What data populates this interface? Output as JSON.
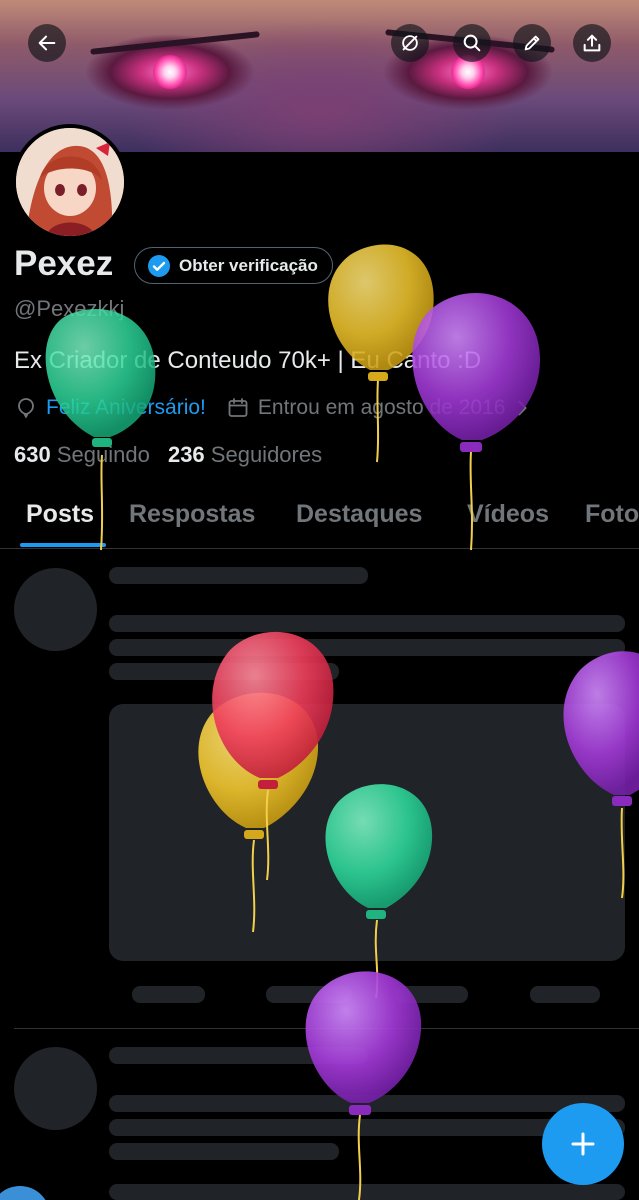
{
  "profile": {
    "name": "Pexez",
    "handle": "@Pexezkkj",
    "verify_button": "Obter verificação",
    "bio": "Ex Criador de Conteudo 70k+ | Eu Canto :D",
    "birthday": "Feliz Aniversário!",
    "joined": "Entrou em agosto de 2016",
    "following_count": "630",
    "following_label": "Seguindo",
    "followers_count": "236",
    "followers_label": "Seguidores"
  },
  "toolbar": {
    "icons": [
      "back-arrow-icon",
      "no-notifications-icon",
      "search-icon",
      "edit-pencil-icon",
      "share-icon"
    ]
  },
  "tabs": [
    {
      "label": "Posts",
      "active": true
    },
    {
      "label": "Respostas",
      "active": false
    },
    {
      "label": "Destaques",
      "active": false
    },
    {
      "label": "Vídeos",
      "active": false
    },
    {
      "label": "Fotos",
      "active": false
    }
  ],
  "colors": {
    "accent": "#1d9bf0",
    "background": "#000000",
    "muted_text": "#71767b",
    "balloon_green": "#2ed69a",
    "balloon_yellow": "#ecc22c",
    "balloon_purple": "#a33ad8",
    "balloon_red": "#ef3d5a"
  },
  "fab": {
    "icon": "plus-icon"
  }
}
